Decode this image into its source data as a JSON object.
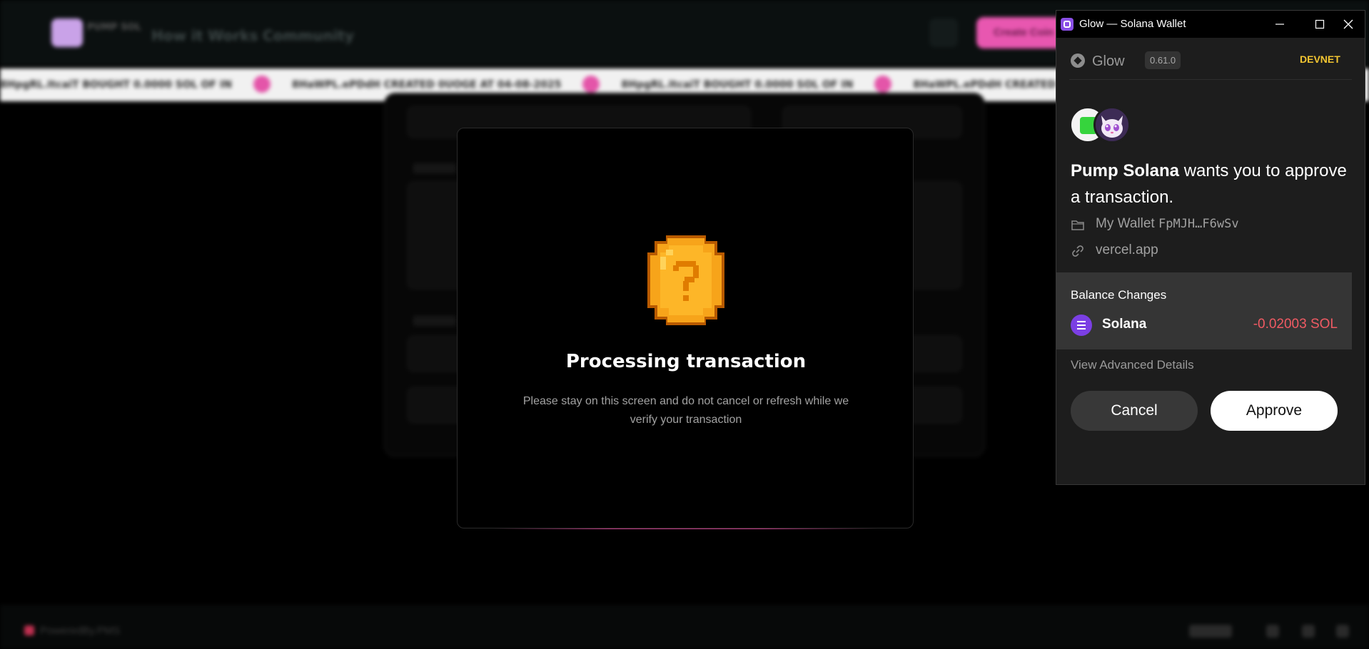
{
  "background_site": {
    "logo_text": "PUMP SOL",
    "nav": [
      "How it Works",
      "Community"
    ],
    "cta_label": "Create Coin",
    "ticker": [
      "8HpgRL.ItcaiT BOUGHT 0.0000 SOL OF IN",
      "8HaWPL.ePDdH CREATED 0UOGE AT 04-08-2025",
      "8HpgRL.ItcaiT BOUGHT 0.0000 SOL OF IN",
      "8HaWPL.ePDdH CREATED"
    ],
    "footer_text": "PoweredBy.PMS"
  },
  "modal": {
    "title": "Processing transaction",
    "description": "Please stay on this screen and do not cancel or refresh while we verify your transaction",
    "icon": "question-coin-icon"
  },
  "wallet": {
    "window_title": "Glow — Solana Wallet",
    "brand_name": "Glow",
    "version": "0.61.0",
    "network": "DEVNET",
    "request": {
      "app_name": "Pump Solana",
      "message": " wants you to approve a transaction."
    },
    "wallet_label": "My Wallet",
    "wallet_address": "FpMJH…F6wSv",
    "origin": "vercel.app",
    "balance_changes": {
      "title": "Balance Changes",
      "items": [
        {
          "token": "Solana",
          "amount": "-0.02003 SOL"
        }
      ]
    },
    "advanced_link": "View Advanced Details",
    "cancel_label": "Cancel",
    "approve_label": "Approve"
  },
  "colors": {
    "accent_pink": "#e857b0",
    "network_yellow": "#f2c531",
    "negative_red": "#f05a63",
    "solana_purple": "#7b3fe4"
  }
}
